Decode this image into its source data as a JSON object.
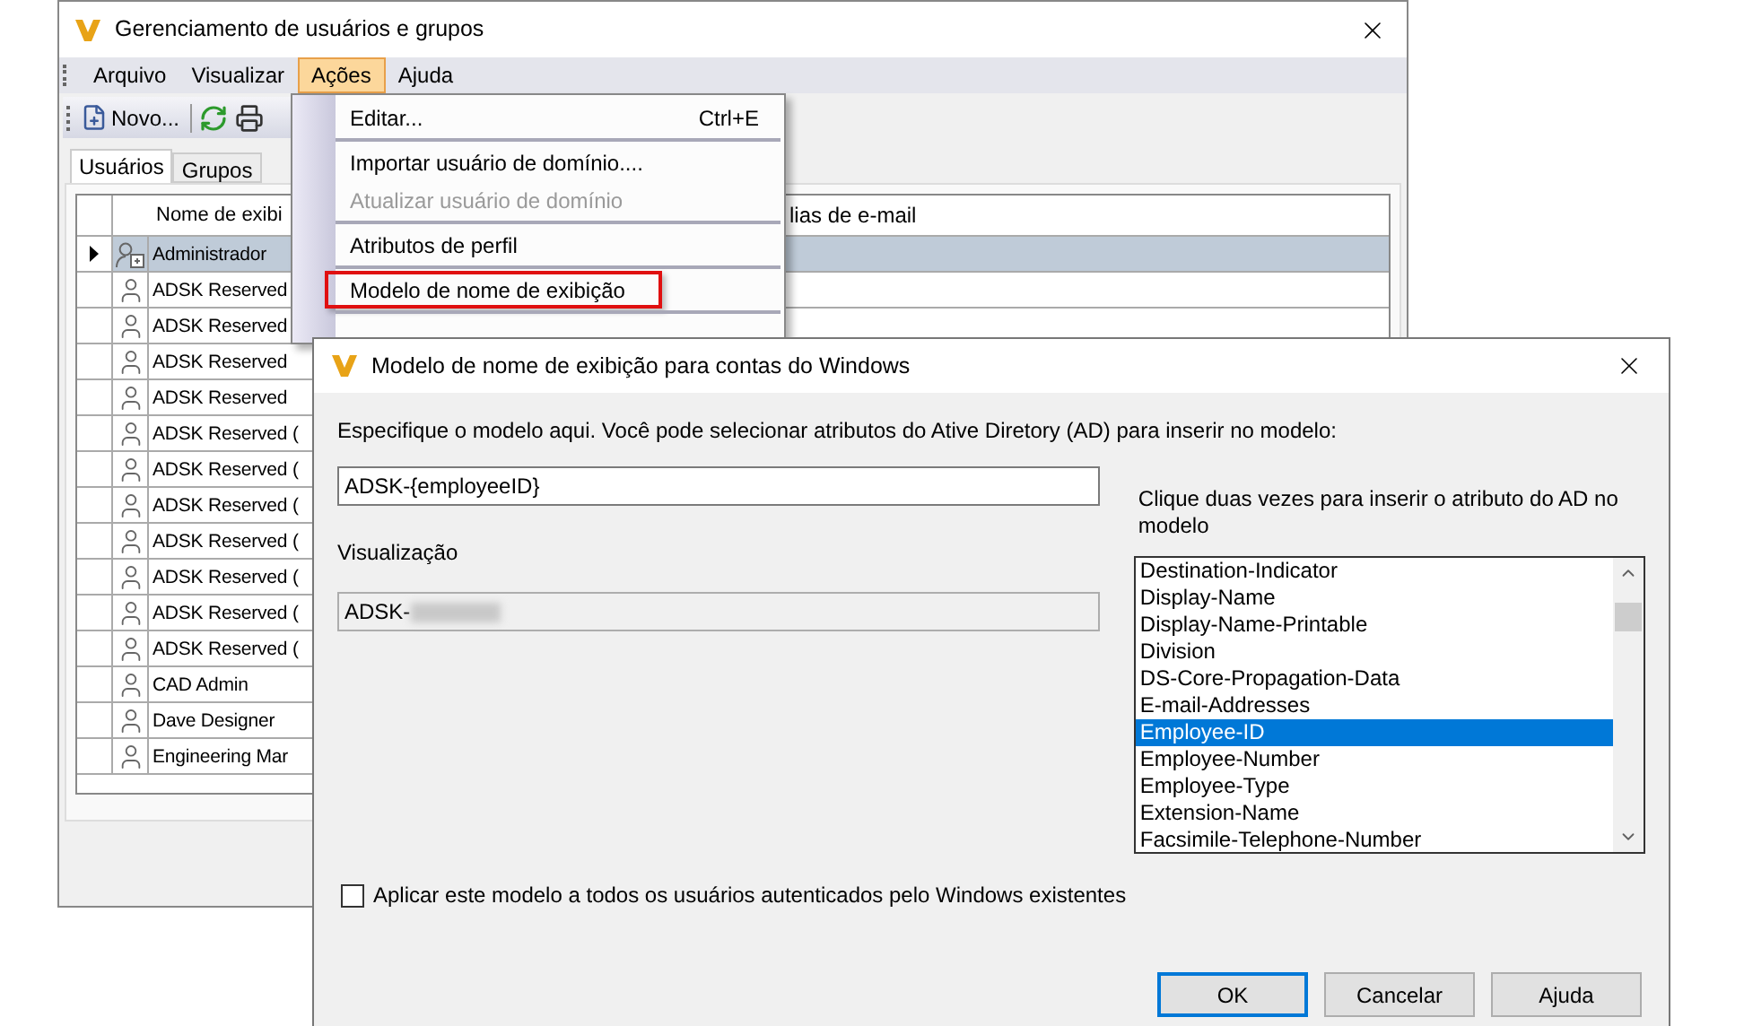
{
  "main_window": {
    "title": "Gerenciamento de usuários e grupos",
    "menu": [
      {
        "label": "Arquivo",
        "selected": false
      },
      {
        "label": "Visualizar",
        "selected": false
      },
      {
        "label": "Ações",
        "selected": true
      },
      {
        "label": "Ajuda",
        "selected": false
      }
    ],
    "toolbar": {
      "new_button": "Novo..."
    },
    "tabs": [
      {
        "label": "Usuários",
        "selected": true
      },
      {
        "label": "Grupos",
        "selected": false
      }
    ],
    "grid": {
      "columns": [
        "Nome de exibi",
        "lias de e-mail"
      ],
      "rows": [
        {
          "name": "Administrador",
          "kind": "admin",
          "selected": true
        },
        {
          "name": "ADSK Reserved",
          "kind": "user",
          "selected": false
        },
        {
          "name": "ADSK Reserved",
          "kind": "user",
          "selected": false
        },
        {
          "name": "ADSK Reserved",
          "kind": "user",
          "selected": false
        },
        {
          "name": "ADSK Reserved",
          "kind": "user",
          "selected": false
        },
        {
          "name": "ADSK Reserved (",
          "kind": "user",
          "selected": false
        },
        {
          "name": "ADSK Reserved (",
          "kind": "user",
          "selected": false
        },
        {
          "name": "ADSK Reserved (",
          "kind": "user",
          "selected": false
        },
        {
          "name": "ADSK Reserved (",
          "kind": "user",
          "selected": false
        },
        {
          "name": "ADSK Reserved (",
          "kind": "user",
          "selected": false
        },
        {
          "name": "ADSK Reserved (",
          "kind": "user",
          "selected": false
        },
        {
          "name": "ADSK Reserved (",
          "kind": "user",
          "selected": false
        },
        {
          "name": "CAD Admin",
          "kind": "user",
          "selected": false
        },
        {
          "name": "Dave Designer",
          "kind": "user",
          "selected": false
        },
        {
          "name": "Engineering Mar",
          "kind": "user",
          "selected": false
        }
      ]
    }
  },
  "actions_menu": {
    "items": [
      {
        "kind": "item",
        "label": "Editar...",
        "shortcut": "Ctrl+E",
        "disabled": false,
        "highlighted": false
      },
      {
        "kind": "separator"
      },
      {
        "kind": "item",
        "label": "Importar usuário de domínio....",
        "disabled": false,
        "highlighted": false
      },
      {
        "kind": "item",
        "label": "Atualizar usuário de domínio",
        "disabled": true,
        "highlighted": false
      },
      {
        "kind": "separator"
      },
      {
        "kind": "item",
        "label": "Atributos de perfil",
        "disabled": false,
        "highlighted": false
      },
      {
        "kind": "separator"
      },
      {
        "kind": "item",
        "label": "Modelo de nome de exibição",
        "disabled": false,
        "highlighted": true
      },
      {
        "kind": "separator"
      }
    ]
  },
  "dialog": {
    "title": "Modelo de nome de exibição para contas do Windows",
    "instruction": "Especifique o modelo aqui. Você pode selecionar atributos do Ative Diretory (AD) para inserir no modelo:",
    "template_field": {
      "value": "ADSK-{employeeID}"
    },
    "preview_label": "Visualização",
    "preview_field": {
      "value": "ADSK-"
    },
    "list_hint": "Clique duas vezes para inserir o atributo do AD no modelo",
    "attributes": [
      {
        "label": "Destination-Indicator",
        "selected": false
      },
      {
        "label": "Display-Name",
        "selected": false
      },
      {
        "label": "Display-Name-Printable",
        "selected": false
      },
      {
        "label": "Division",
        "selected": false
      },
      {
        "label": "DS-Core-Propagation-Data",
        "selected": false
      },
      {
        "label": "E-mail-Addresses",
        "selected": false
      },
      {
        "label": "Employee-ID",
        "selected": true
      },
      {
        "label": "Employee-Number",
        "selected": false
      },
      {
        "label": "Employee-Type",
        "selected": false
      },
      {
        "label": "Extension-Name",
        "selected": false
      },
      {
        "label": "Facsimile-Telephone-Number",
        "selected": false
      }
    ],
    "apply_all": {
      "label": "Aplicar este modelo a todos os usuários autenticados pelo Windows existentes",
      "checked": false
    },
    "buttons": [
      {
        "label": "OK",
        "default": true
      },
      {
        "label": "Cancelar",
        "default": false
      },
      {
        "label": "Ajuda",
        "default": false
      }
    ]
  }
}
